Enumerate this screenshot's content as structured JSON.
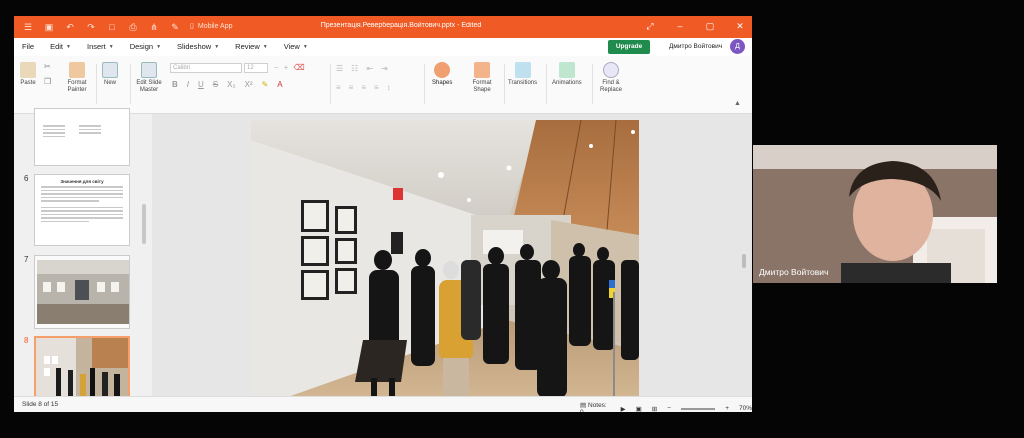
{
  "window": {
    "mobile_app": "Mobile App",
    "title": "Презентація.Реверберація.Войтович.pptx - Edited"
  },
  "menu": [
    "File",
    "Edit",
    "Insert",
    "Design",
    "Slideshow",
    "Review",
    "View"
  ],
  "account": {
    "upgrade": "Upgrade",
    "user": "Дмитро Войтович",
    "avatar_letter": "Д"
  },
  "ribbon": {
    "paste": "Paste",
    "format_painter": "Format Painter",
    "new": "New",
    "edit_slide_master": "Edit Slide Master",
    "font": "Calibri",
    "size": "12",
    "shapes": "Shapes",
    "format_shape": "Format Shape",
    "transitions": "Transitions",
    "animations": "Animations",
    "find_replace": "Find & Replace"
  },
  "thumbnails": {
    "slide6_num": "6",
    "slide6_title": "Значення для світу",
    "slide7_num": "7",
    "slide8_num": "8"
  },
  "status": {
    "slide": "Slide 8 of 15",
    "notes": "Notes: 0",
    "zoom": "70%"
  },
  "video": {
    "participant": "Дмитро Войтович"
  },
  "colors": {
    "accent": "#f05a24",
    "upgrade": "#1f8b4c",
    "avatar": "#7d57c1"
  }
}
